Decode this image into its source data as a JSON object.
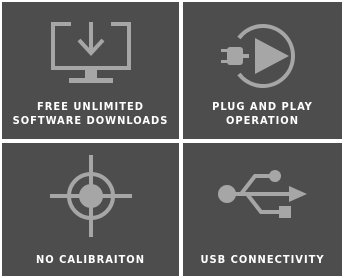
{
  "tiles": [
    {
      "icon": "monitor-download-icon",
      "lines": [
        "FREE UNLIMITED",
        "SOFTWARE DOWNLOADS"
      ]
    },
    {
      "icon": "plug-play-icon",
      "lines": [
        "PLUG AND PLAY",
        "OPERATION"
      ]
    },
    {
      "icon": "crosshair-icon",
      "lines": [
        "NO CALIBRAITON"
      ]
    },
    {
      "icon": "usb-icon",
      "lines": [
        "USB CONNECTIVITY"
      ]
    }
  ],
  "colors": {
    "tile": "#4d4d4d",
    "icon": "#a6a6a6",
    "text": "#ffffff"
  }
}
